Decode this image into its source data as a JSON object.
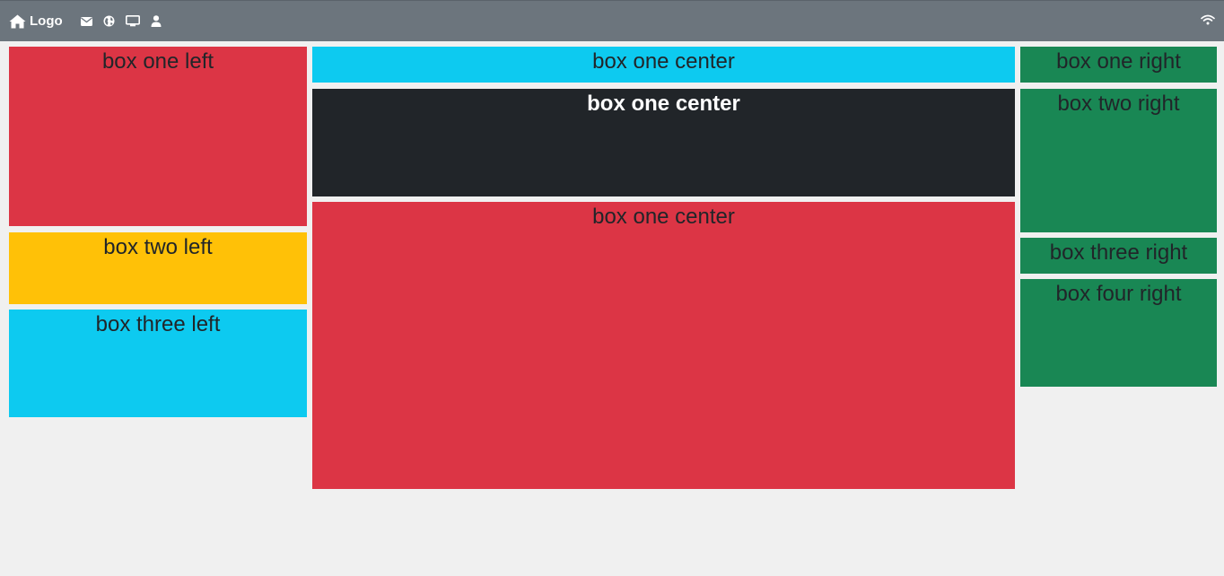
{
  "navbar": {
    "brand_label": "Logo",
    "icons": [
      "home-icon",
      "envelope-icon",
      "globe-icon",
      "monitor-icon",
      "user-icon",
      "wifi-icon"
    ],
    "background": "#6c757d"
  },
  "left": {
    "box1": "box one left",
    "box2": "box two left",
    "box3": "box three left"
  },
  "center": {
    "box1": "box one center",
    "box2": "box one center",
    "box3": "box one center"
  },
  "right": {
    "box1": "box one right",
    "box2": "box two right",
    "box3": "box three right",
    "box4": "box four right"
  },
  "colors": {
    "red": "#dc3545",
    "yellow": "#ffc107",
    "cyan": "#0dcaf0",
    "dark": "#212529",
    "green": "#198754",
    "page_background": "#f0f0f0"
  }
}
